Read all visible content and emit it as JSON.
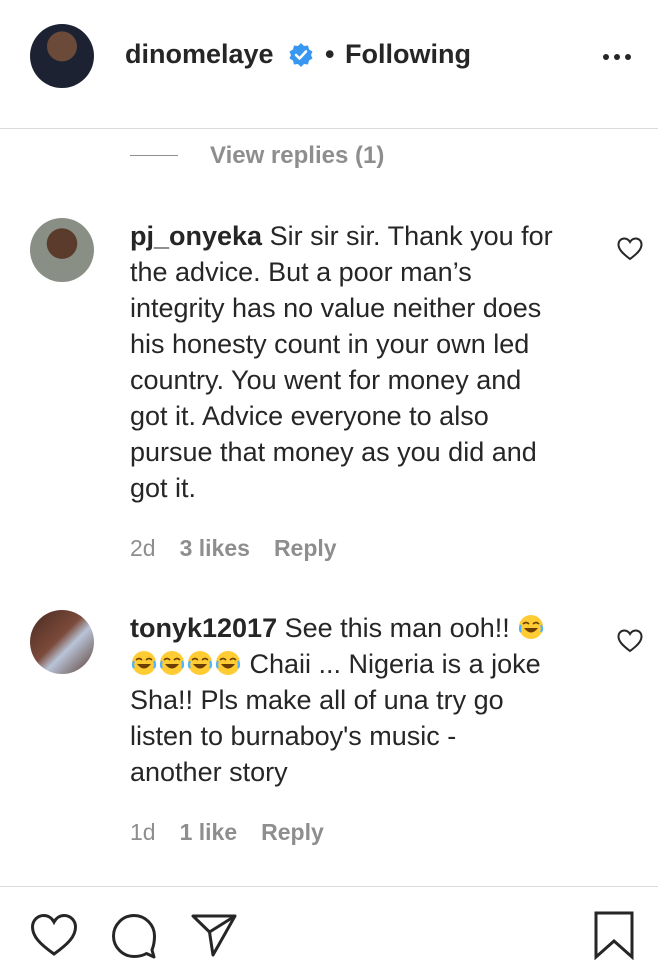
{
  "header": {
    "username": "dinomelaye",
    "dot": "•",
    "follow_status": "Following"
  },
  "view_replies": "View replies (1)",
  "comments": [
    {
      "username": "pj_onyeka",
      "text_lines": [
        " Sir sir sir. Thank you for",
        "the advice. But a poor man’s",
        "integrity has no value neither does",
        "his honesty count in your own led",
        "country. You went for money and",
        "got it. Advice everyone to also",
        "pursue that money as you did and",
        "got it."
      ],
      "age": "2d",
      "likes": "3 likes",
      "reply": "Reply"
    },
    {
      "username": "tonyk12017",
      "line1": " See this man ooh!! ",
      "line2": " Chaii ... Nigeria is a joke",
      "text_lines": [
        "Sha!! Pls make all of una try go",
        "listen to burnaboy's music -",
        "another story"
      ],
      "emoji": "face-with-tears-of-joy",
      "age": "1d",
      "likes": "1 like",
      "reply": "Reply"
    }
  ],
  "icons": {
    "like": "heart-icon",
    "comment": "comment-icon",
    "share": "paper-plane-icon",
    "save": "bookmark-icon",
    "verified_color": "#3897f0"
  }
}
